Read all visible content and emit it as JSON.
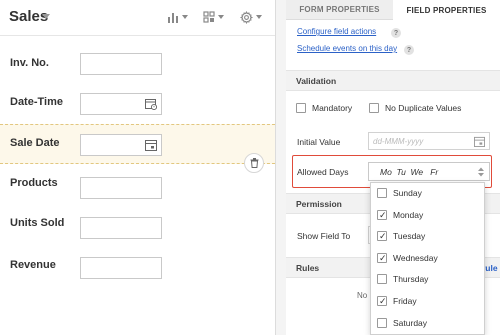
{
  "form": {
    "title": "Sales",
    "fields": [
      {
        "label": "Inv. No.",
        "type": "text"
      },
      {
        "label": "Date-Time",
        "type": "datetime"
      },
      {
        "label": "Sale Date",
        "type": "date",
        "selected": true
      },
      {
        "label": "Products",
        "type": "text"
      },
      {
        "label": "Units Sold",
        "type": "text"
      },
      {
        "label": "Revenue",
        "type": "text"
      }
    ],
    "toolbar_icons": [
      "bar-chart-icon",
      "layout-icon",
      "gear-icon"
    ]
  },
  "panel": {
    "tabs": {
      "form": "FORM PROPERTIES",
      "field": "FIELD PROPERTIES",
      "active": "field"
    },
    "links": {
      "configure": "Configure field actions",
      "schedule": "Schedule events on this day",
      "help": "?"
    },
    "validation": {
      "heading": "Validation",
      "mandatory": "Mandatory",
      "no_duplicates": "No Duplicate Values",
      "initial_value_label": "Initial Value",
      "initial_value_placeholder": "dd-MMM-yyyy",
      "allowed_days_label": "Allowed Days",
      "allowed_days_value": "Mo  Tu  We   Fr"
    },
    "permission": {
      "heading": "Permission",
      "show_field_to": "Show Field To"
    },
    "rules": {
      "heading": "Rules",
      "right_fragment": "rule",
      "body_fragment": "No"
    },
    "days": [
      {
        "label": "Sunday",
        "checked": false
      },
      {
        "label": "Monday",
        "checked": true
      },
      {
        "label": "Tuesday",
        "checked": true
      },
      {
        "label": "Wednesday",
        "checked": true
      },
      {
        "label": "Thursday",
        "checked": false
      },
      {
        "label": "Friday",
        "checked": true
      },
      {
        "label": "Saturday",
        "checked": false
      }
    ]
  },
  "colors": {
    "accent_link": "#2b61c7",
    "highlight": "#e04b3a",
    "selected_row": "#fdf8ea"
  }
}
